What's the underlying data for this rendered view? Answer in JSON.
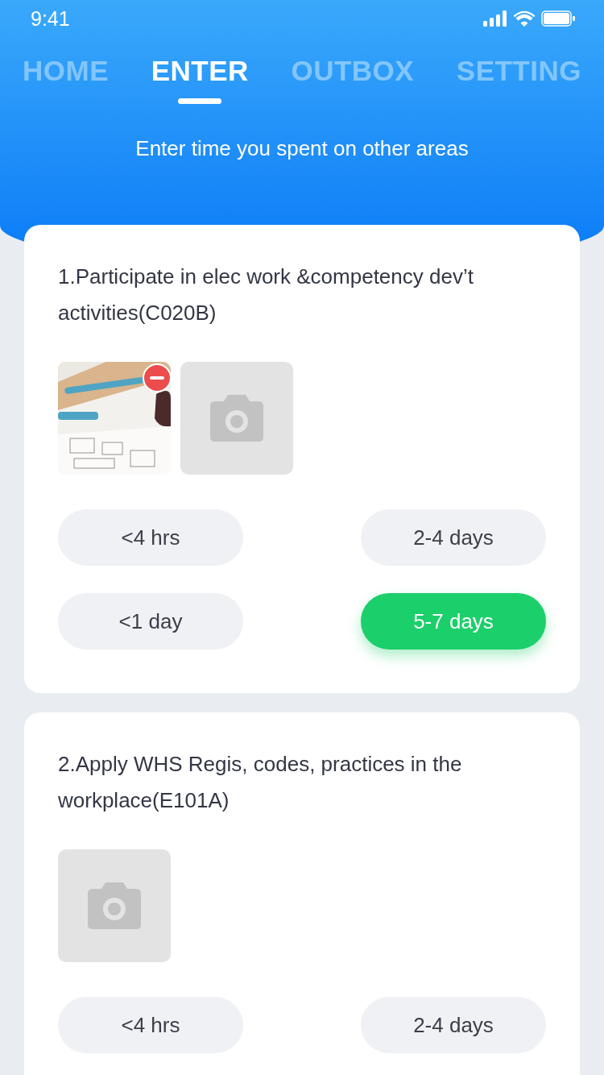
{
  "status_bar": {
    "time": "9:41"
  },
  "tabs": [
    {
      "label": "HOME",
      "selected": false
    },
    {
      "label": "ENTER",
      "selected": true
    },
    {
      "label": "OUTBOX",
      "selected": false
    },
    {
      "label": "SETTING",
      "selected": false
    }
  ],
  "subtitle": "Enter time you spent on other areas",
  "tasks": [
    {
      "title": "1.Participate in elec work &competency dev’t activities(C020B)",
      "attachments": [
        {
          "kind": "picture",
          "removable": true
        },
        {
          "kind": "add-photo"
        }
      ],
      "options": [
        {
          "label": "<4 hrs",
          "selected": false
        },
        {
          "label": "2-4 days",
          "selected": false
        },
        {
          "label": "<1 day",
          "selected": false
        },
        {
          "label": "5-7 days",
          "selected": true
        }
      ]
    },
    {
      "title": "2.Apply WHS Regis, codes, practices in the workplace(E101A)",
      "attachments": [
        {
          "kind": "add-photo"
        }
      ],
      "options": [
        {
          "label": "<4 hrs",
          "selected": false
        },
        {
          "label": "2-4 days",
          "selected": false
        }
      ]
    }
  ]
}
